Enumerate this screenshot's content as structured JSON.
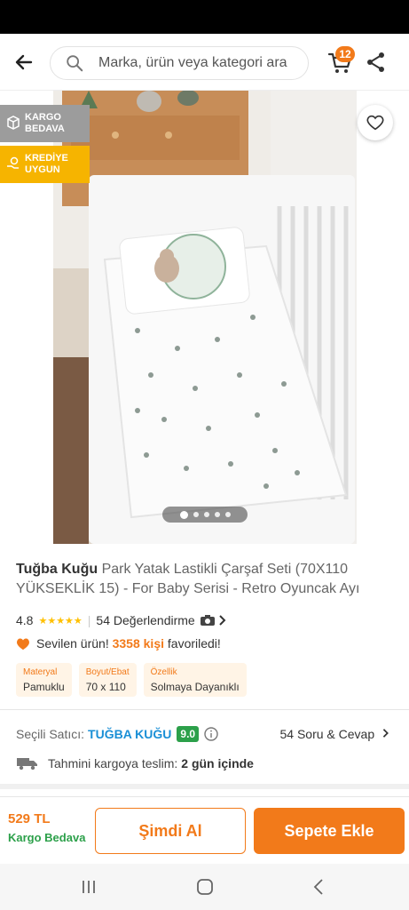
{
  "search": {
    "placeholder": "Marka, ürün veya kategori ara"
  },
  "header": {
    "cart_count": "12"
  },
  "badges": {
    "kargo_line1": "KARGO",
    "kargo_line2": "BEDAVA",
    "kredi_line1": "KREDİYE",
    "kredi_line2": "UYGUN"
  },
  "gallery": {
    "image_count": 5,
    "active_index": 0
  },
  "product": {
    "brand": "Tuğba Kuğu",
    "name": "Park Yatak Lastikli Çarşaf Seti (70X110 YÜKSEKLİK 15) - For Baby Serisi - Retro Oyuncak Ayı",
    "rating": "4.8",
    "stars": "★★★★★",
    "review_count": "54 Değerlendirme",
    "favorite_prefix": "Sevilen ürün!",
    "favorite_count": "3358 kişi",
    "favorite_suffix": "favoriledi!"
  },
  "attributes": [
    {
      "key": "Materyal",
      "value": "Pamuklu"
    },
    {
      "key": "Boyut/Ebat",
      "value": "70 x 110"
    },
    {
      "key": "Özellik",
      "value": "Solmaya Dayanıklı"
    }
  ],
  "seller": {
    "label": "Seçili Satıcı:",
    "name": "TUĞBA KUĞU",
    "score": "9.0",
    "qa": "54 Soru & Cevap"
  },
  "shipping": {
    "label": "Tahmini kargoya teslim:",
    "value": "2 gün içinde"
  },
  "bottom": {
    "price": "529 TL",
    "free_shipping": "Kargo Bedava",
    "buy_now": "Şimdi Al",
    "add_to_cart": "Sepete Ekle"
  },
  "colors": {
    "accent": "#f27a1a",
    "success": "#2ca04a",
    "seller_link": "#1a8fd6",
    "kredi_badge": "#f6b400",
    "kargo_badge": "#9c9c9c"
  }
}
